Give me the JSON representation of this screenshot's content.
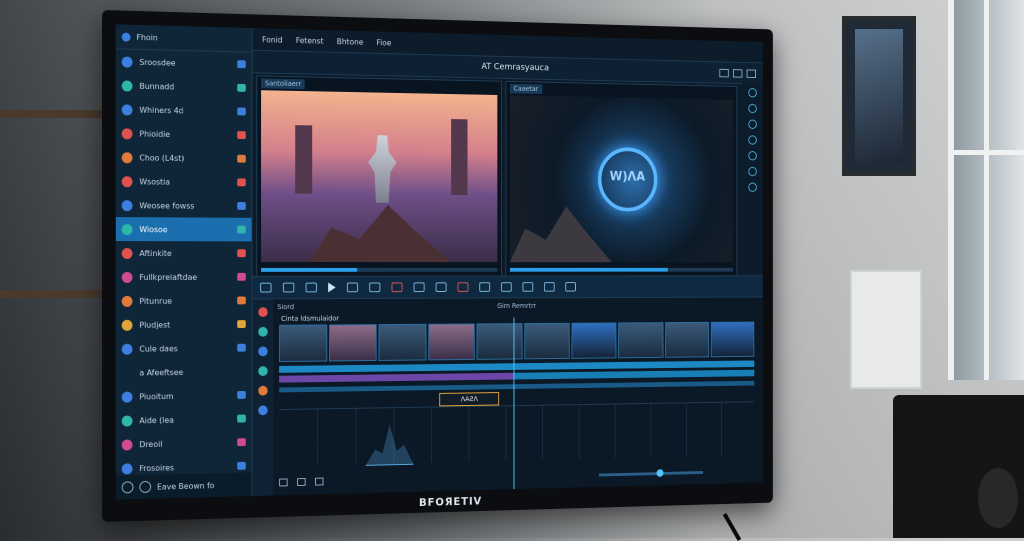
{
  "monitor": {
    "brand": "BFOЯETIV"
  },
  "sidebar": {
    "header": "Fhoin",
    "items": [
      {
        "label": "Sroosdee",
        "icon": "circle-icon",
        "color": "#3d7fe0"
      },
      {
        "label": "Bunnadd",
        "icon": "circle-icon",
        "color": "#2fb6a8"
      },
      {
        "label": "Whiners 4d",
        "icon": "circle-icon",
        "color": "#3d7fe0"
      },
      {
        "label": "Phioidie",
        "icon": "circle-icon",
        "color": "#e0524f"
      },
      {
        "label": "Choo (L4st)",
        "icon": "circle-icon",
        "color": "#e07b3b"
      },
      {
        "label": "Wsostia",
        "icon": "circle-icon",
        "color": "#e0524f"
      },
      {
        "label": "Weosee fowss",
        "icon": "circle-icon",
        "color": "#3d7fe0"
      },
      {
        "label": "Wiosoe",
        "icon": "circle-icon",
        "color": "#2fb6a8",
        "active": true
      },
      {
        "label": "Aftinkite",
        "icon": "circle-icon",
        "color": "#e0524f"
      },
      {
        "label": "Fullkpreiaftdae",
        "icon": "circle-icon",
        "color": "#d04a8e"
      },
      {
        "label": "Pitunrue",
        "icon": "circle-icon",
        "color": "#e07b3b"
      },
      {
        "label": "Pludjest",
        "icon": "circle-icon",
        "color": "#e0a63b"
      },
      {
        "label": "Cule daes",
        "icon": "circle-icon",
        "color": "#3d7fe0"
      },
      {
        "label": "a Afeeftsee",
        "icon": "none",
        "color": "#0f2538"
      },
      {
        "label": "Piuoitum",
        "icon": "circle-icon",
        "color": "#3d7fe0"
      },
      {
        "label": "Aide (lea",
        "icon": "circle-icon",
        "color": "#2fb6a8"
      },
      {
        "label": "Dreoil",
        "icon": "circle-icon",
        "color": "#d04a8e"
      },
      {
        "label": "Frosoires",
        "icon": "circle-icon",
        "color": "#3d7fe0"
      }
    ],
    "footer": "Eave Beown fo"
  },
  "menubar": {
    "items": [
      "Fonid",
      "Fetenst",
      "Bhtone",
      "Fioe"
    ]
  },
  "title": {
    "text": "AT Cemrasyauca"
  },
  "viewers": {
    "left_label": "Santoliaerr",
    "right_label": "Caaetar",
    "right_logo": "W)ɅA"
  },
  "timeline": {
    "head_left": "Siord",
    "head_right": "Gim Remrtrr",
    "track_label": "Cinta ldsmulaidor",
    "marker_label": "ɅAƧɅ"
  }
}
